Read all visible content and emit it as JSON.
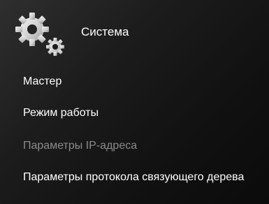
{
  "header": {
    "icon": "gears-icon",
    "title": "Система"
  },
  "menu": {
    "items": [
      {
        "label": "Мастер",
        "state": "enabled"
      },
      {
        "label": "Режим работы",
        "state": "enabled"
      },
      {
        "label": "Параметры IP-адреса",
        "state": "disabled"
      },
      {
        "label": "Параметры протокола связующего дерева",
        "state": "enabled"
      }
    ]
  },
  "colors": {
    "text": "#ffffff",
    "disabled_text": "#8a8a8a",
    "gear": "#d8d8d8"
  }
}
